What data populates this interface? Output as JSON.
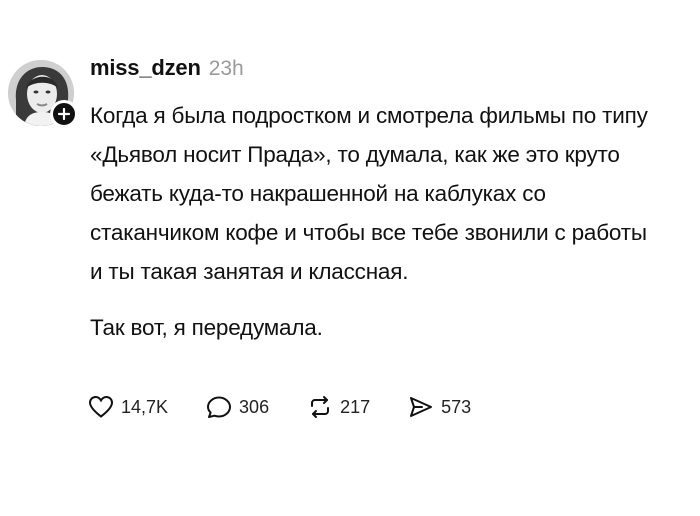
{
  "post": {
    "author": {
      "username": "miss_dzen",
      "time_ago": "23h",
      "avatar_icon": "avatar-photo",
      "follow_icon": "plus-icon"
    },
    "paragraphs": [
      "Когда я была подростком и смотрела фильмы по типу «Дьявол носит Прада», то думала, как же это круто бежать куда-то накрашенной на каблуках со стаканчиком кофе и чтобы все тебе звонили с работы и ты такая занятая и классная.",
      "Так вот, я передумала."
    ],
    "actions": {
      "likes": {
        "icon": "heart-icon",
        "count": "14,7K"
      },
      "replies": {
        "icon": "comment-icon",
        "count": "306"
      },
      "reposts": {
        "icon": "repost-icon",
        "count": "217"
      },
      "shares": {
        "icon": "send-icon",
        "count": "573"
      }
    }
  }
}
